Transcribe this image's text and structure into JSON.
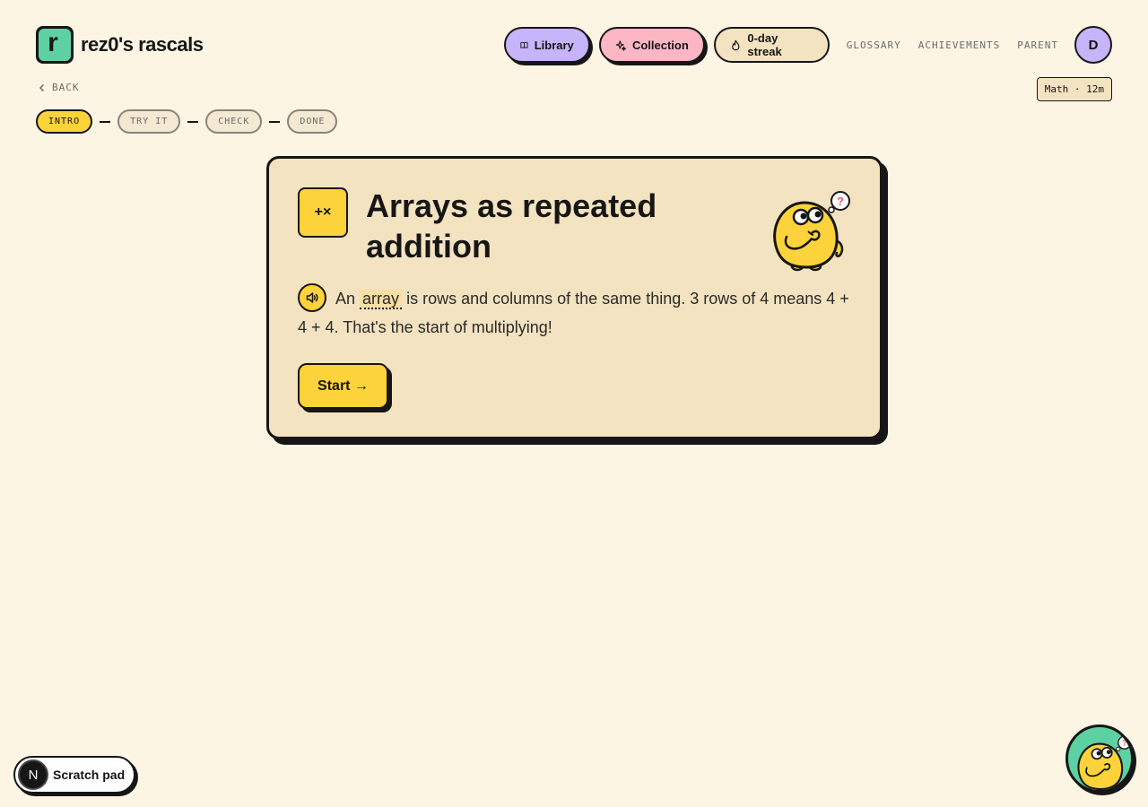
{
  "brand": {
    "name": "rez0's rascals",
    "logo_letter": "r"
  },
  "nav": {
    "library": "Library",
    "collection": "Collection",
    "streak": "0-day streak",
    "links": [
      "GLOSSARY",
      "ACHIEVEMENTS",
      "PARENT"
    ],
    "avatar_initial": "D"
  },
  "back_label": "BACK",
  "meta_badge": "Math · 12m",
  "steps": [
    "INTRO",
    "TRY IT",
    "CHECK",
    "DONE"
  ],
  "lesson": {
    "icon_text": "+×",
    "title": "Arrays as repeated addition",
    "body_pre": "An",
    "vocab_word": "array",
    "body_post": "is rows and columns of the same thing. 3 rows of 4 means 4 + 4 + 4. That's the start of multiplying!",
    "start_label": "Start →"
  },
  "scratch": {
    "badge": "N",
    "label": "Scratch pad"
  },
  "colors": {
    "background": "#fdf5e4",
    "card": "#f4e3c0",
    "yellow": "#fcd33a",
    "purple": "#c7b4fb",
    "pink": "#fdb6c3",
    "green": "#5dd1a2",
    "ink": "#161616"
  },
  "icons": [
    "book-icon",
    "sparkles-icon",
    "flame-icon",
    "chevron-left-icon",
    "speaker-icon",
    "mascot-icon"
  ]
}
